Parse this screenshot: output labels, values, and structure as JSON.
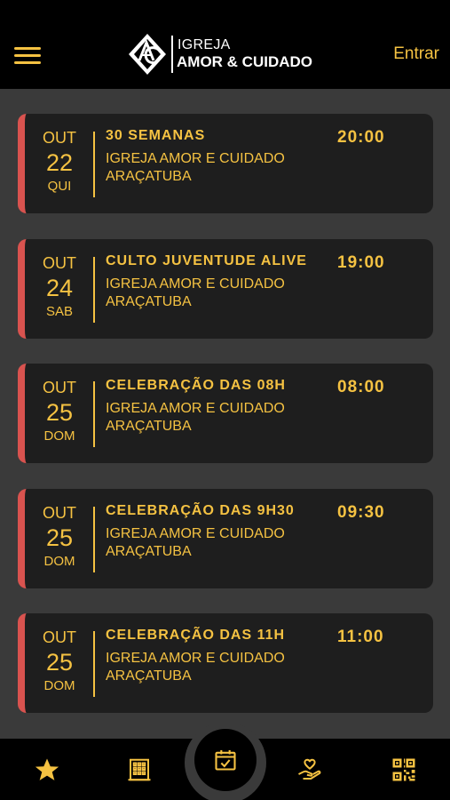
{
  "header": {
    "logo_line1": "IGREJA",
    "logo_line2": "AMOR & CUIDADO",
    "login_label": "Entrar"
  },
  "events": [
    {
      "month": "OUT",
      "day": "22",
      "weekday": "QUI",
      "title": "30 SEMANAS",
      "location": "IGREJA AMOR E CUIDADO ARAÇATUBA",
      "time": "20:00"
    },
    {
      "month": "OUT",
      "day": "24",
      "weekday": "SAB",
      "title": "CULTO JUVENTUDE ALIVE",
      "location": "IGREJA AMOR E CUIDADO ARAÇATUBA",
      "time": "19:00"
    },
    {
      "month": "OUT",
      "day": "25",
      "weekday": "DOM",
      "title": "CELEBRAÇÃO DAS 08H",
      "location": "IGREJA AMOR E CUIDADO ARAÇATUBA",
      "time": "08:00"
    },
    {
      "month": "OUT",
      "day": "25",
      "weekday": "DOM",
      "title": "CELEBRAÇÃO DAS 9H30",
      "location": "IGREJA AMOR E CUIDADO ARAÇATUBA",
      "time": "09:30"
    },
    {
      "month": "OUT",
      "day": "25",
      "weekday": "DOM",
      "title": "CELEBRAÇÃO DAS 11H",
      "location": "IGREJA AMOR E CUIDADO ARAÇATUBA",
      "time": "11:00"
    }
  ],
  "bottom_nav": {
    "items": [
      "star-icon",
      "building-icon",
      "calendar-check-icon",
      "hand-heart-icon",
      "qr-code-icon"
    ],
    "active": "calendar-check-icon"
  },
  "colors": {
    "accent": "#f5c242",
    "card_background": "#1e1e1e",
    "card_stripe": "#d9534f",
    "page_background": "#3a3a3a",
    "bar_background": "#000000"
  }
}
